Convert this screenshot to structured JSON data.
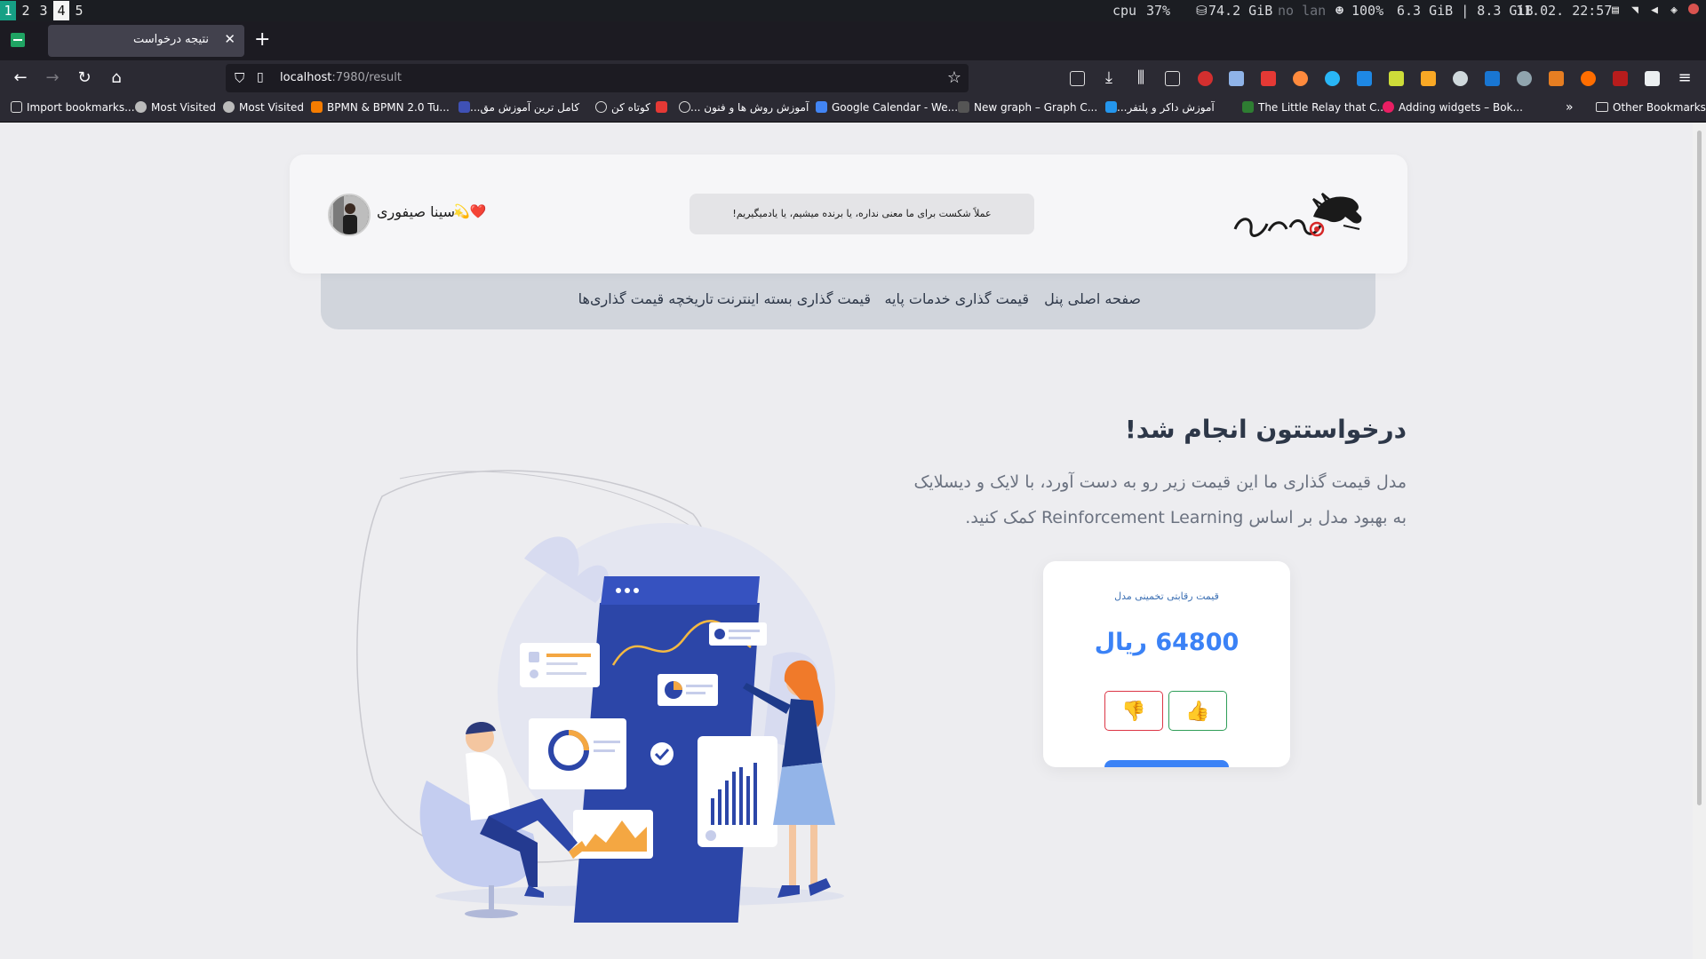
{
  "wm": {
    "workspaces": [
      "1",
      "2",
      "3",
      "4",
      "5"
    ],
    "cpu_label": "cpu",
    "cpu_value": "37%",
    "disk": "74.2 GiB",
    "network": "no lan",
    "battery": "100%",
    "memory": "6.3 GiB | 8.3 GiB",
    "datetime": "11.02. 22:57"
  },
  "browser": {
    "tab_title": "نتیجه درخواست",
    "url_host": "localhost",
    "url_path": ":7980/result",
    "bookmarks": [
      "Import bookmarks...",
      "Most Visited",
      "Most Visited",
      "BPMN & BPMN 2.0 Tu...",
      "کامل ترین آموزش مق...",
      "کوتاه کن",
      "آموزش روش ها و فنون ...",
      "Google Calendar - We...",
      "New graph – Graph C...",
      "آموزش داکر و پلتفر...",
      "The Little Relay that C...",
      "Adding widgets – Bok..."
    ],
    "other_bookmarks": "Other Bookmarks"
  },
  "header": {
    "motto": "عملاً شکست برای ما معنی نداره، یا برنده میشیم، یا یادمیگیریم!",
    "user_name": "سینا صیفوری",
    "user_emoji": "💫❤️"
  },
  "nav": {
    "items": [
      "صفحه اصلی پنل",
      "قیمت گذاری خدمات پایه",
      "قیمت گذاری بسته اینترنت",
      "تاریخچه قیمت گذاری‌ها"
    ]
  },
  "main": {
    "headline": "درخواستتون انجام شد!",
    "description": "مدل قیمت گذاری ما این قیمت زیر رو به دست آورد، با لایک و دیسلایک به بهبود مدل بر اساس Reinforcement Learning کمک کنید."
  },
  "result_card": {
    "label": "قیمت رقابتی تخمینی مدل",
    "price": "64800 ریال",
    "like_icon": "👍",
    "dislike_icon": "👎"
  },
  "colors": {
    "accent": "#3b82f6",
    "dislike": "#dc3545",
    "like": "#2f9e58",
    "brand_red": "#d62828"
  }
}
